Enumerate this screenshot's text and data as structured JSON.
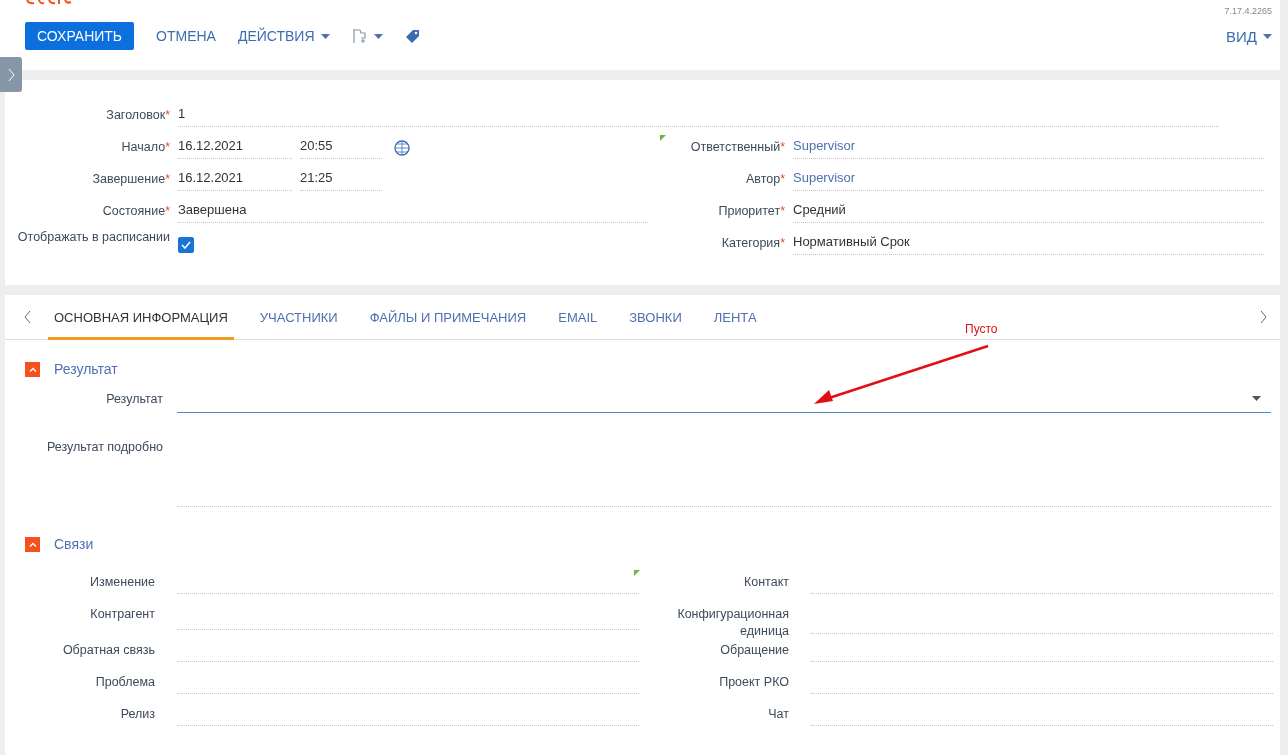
{
  "toolbar": {
    "buttons": [
      {
        "kind": "primary",
        "label": "СОХРАНИТЬ"
      },
      {
        "kind": "link",
        "label": "ОТМЕНА"
      },
      {
        "kind": "menu",
        "label": "ДЕЙСТВИЯ"
      },
      {
        "kind": "flag"
      },
      {
        "kind": "tag"
      }
    ],
    "version": "7.17.4.2265",
    "view_button": "ВИД"
  },
  "header": {
    "title": {
      "label": "Заголовок",
      "req": "*",
      "value": "1"
    },
    "left_fields": [
      {
        "kind": "datetime",
        "label": "Начало",
        "req": "*",
        "date": "16.12.2021",
        "time": "20:55",
        "timezone": true
      },
      {
        "kind": "datetime",
        "label": "Завершение",
        "req": "*",
        "date": "16.12.2021",
        "time": "21:25",
        "timezone": false
      },
      {
        "kind": "text",
        "label": "Состояние",
        "req": "*",
        "value": "Завершена"
      },
      {
        "kind": "checkbox",
        "label": "Отображать в расписании",
        "checked": true
      }
    ],
    "right_fields": [
      {
        "label": "Ответственный",
        "req": "*",
        "value": "Supervisor",
        "link": true,
        "marker": true
      },
      {
        "label": "Автор",
        "req": "*",
        "value": "Supervisor",
        "link": true,
        "marker": false
      },
      {
        "label": "Приоритет",
        "req": "*",
        "value": "Средний",
        "link": false,
        "marker": false
      },
      {
        "label": "Категория",
        "req": "*",
        "value": "Нормативный Срок",
        "link": false,
        "marker": false
      }
    ]
  },
  "tabs": [
    {
      "label": "ОСНОВНАЯ ИНФОРМАЦИЯ",
      "selected": true
    },
    {
      "label": "УЧАСТНИКИ",
      "selected": false
    },
    {
      "label": "ФАЙЛЫ И ПРИМЕЧАНИЯ",
      "selected": false
    },
    {
      "label": "EMAIL",
      "selected": false
    },
    {
      "label": "ЗВОНКИ",
      "selected": false
    },
    {
      "label": "ЛЕНТА",
      "selected": false
    }
  ],
  "annotation": {
    "text": "Пусто"
  },
  "result_group": {
    "title": "Результат",
    "expanded": true,
    "fields": [
      {
        "kind": "lookup",
        "label": "Результат",
        "focused": true
      },
      {
        "kind": "textarea",
        "label": "Результат подробно"
      }
    ]
  },
  "links_group": {
    "title": "Связи",
    "expanded": true,
    "left_fields": [
      {
        "label": "Изменение",
        "marker": false
      },
      {
        "label": "Контрагент",
        "marker": false
      },
      {
        "label": "Обратная связь",
        "marker": false
      },
      {
        "label": "Проблема",
        "marker": false
      },
      {
        "label": "Релиз",
        "marker": false
      }
    ],
    "right_fields": [
      {
        "label": "Контакт",
        "marker": true
      },
      {
        "label": "Конфигурационная единица",
        "marker": false
      },
      {
        "label": "Обращение",
        "marker": false
      },
      {
        "label": "Проект РКО",
        "marker": false
      },
      {
        "label": "Чат",
        "marker": false
      }
    ]
  }
}
